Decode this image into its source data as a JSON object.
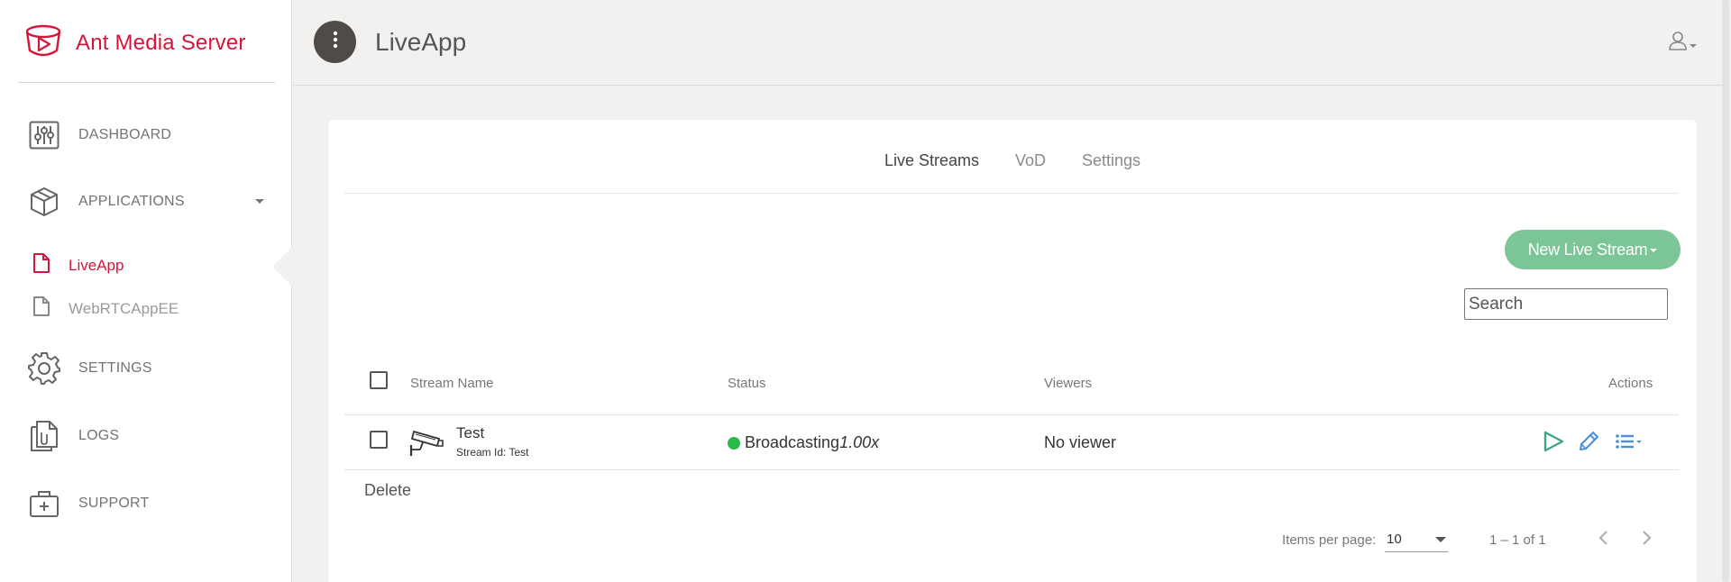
{
  "brand": {
    "name": "Ant Media Server",
    "color": "#d6153a"
  },
  "sidebar": {
    "items": [
      {
        "label": "DASHBOARD",
        "icon": "dashboard-sliders-icon"
      },
      {
        "label": "APPLICATIONS",
        "icon": "cube-icon"
      },
      {
        "label": "SETTINGS",
        "icon": "gear-icon"
      },
      {
        "label": "LOGS",
        "icon": "logs-file-icon"
      },
      {
        "label": "SUPPORT",
        "icon": "medkit-icon"
      }
    ],
    "applications": [
      {
        "label": "LiveApp",
        "icon": "file-icon",
        "active": true
      },
      {
        "label": "WebRTCAppEE",
        "icon": "file-icon",
        "active": false
      }
    ]
  },
  "header": {
    "title": "LiveApp",
    "menu_icon": "vertical-dots-icon",
    "user_icon": "user-icon"
  },
  "tabs": [
    {
      "label": "Live Streams",
      "active": true
    },
    {
      "label": "VoD",
      "active": false
    },
    {
      "label": "Settings",
      "active": false
    }
  ],
  "toolbar": {
    "new_stream_label": "New Live Stream",
    "search_placeholder": "Search"
  },
  "table": {
    "headers": {
      "name": "Stream Name",
      "status": "Status",
      "viewers": "Viewers",
      "actions": "Actions"
    },
    "rows": [
      {
        "name": "Test",
        "stream_id": "Stream Id: Test",
        "status": "Broadcasting",
        "speed": "1.00x",
        "viewers": "No viewer",
        "icon": "security-camera-icon",
        "status_color": "#2db84b"
      }
    ],
    "delete_label": "Delete"
  },
  "pagination": {
    "items_per_page_label": "Items per page:",
    "items_per_page": "10",
    "range": "1 – 1 of 1"
  },
  "colors": {
    "accent_green": "#7cc597",
    "action_teal": "#3aa888",
    "action_blue": "#4a90d9"
  }
}
